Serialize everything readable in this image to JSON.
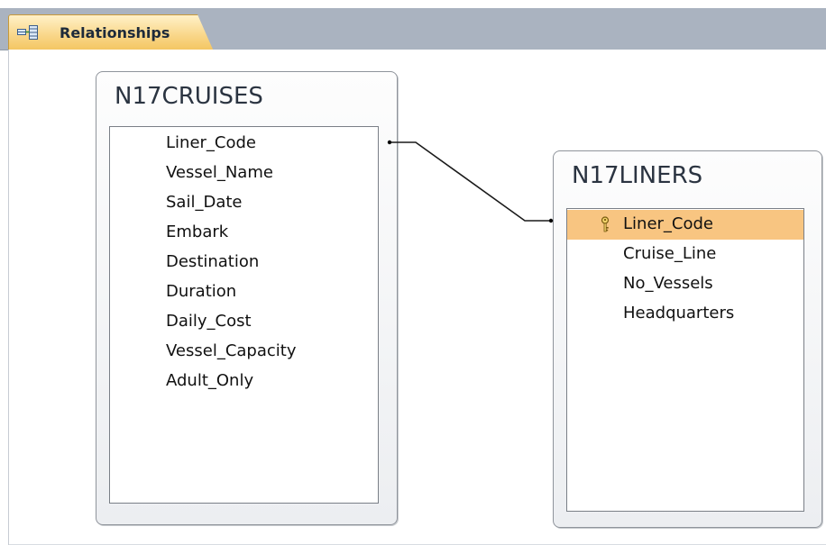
{
  "tab": {
    "label": "Relationships",
    "icon": "relationships-icon"
  },
  "tables": {
    "cruises": {
      "name": "N17CRUISES",
      "fields": [
        "Liner_Code",
        "Vessel_Name",
        "Sail_Date",
        "Embark",
        "Destination",
        "Duration",
        "Daily_Cost",
        "Vessel_Capacity",
        "Adult_Only"
      ]
    },
    "liners": {
      "name": "N17LINERS",
      "fields": [
        "Liner_Code",
        "Cruise_Line",
        "No_Vessels",
        "Headquarters"
      ],
      "primary_key": "Liner_Code",
      "selected_field": "Liner_Code"
    }
  },
  "relationship": {
    "from": "N17CRUISES.Liner_Code",
    "to": "N17LINERS.Liner_Code"
  },
  "colors": {
    "tab_accent": "#f9d78a",
    "selected_row": "#f8c581",
    "tabstrip": "#aab3c0"
  }
}
